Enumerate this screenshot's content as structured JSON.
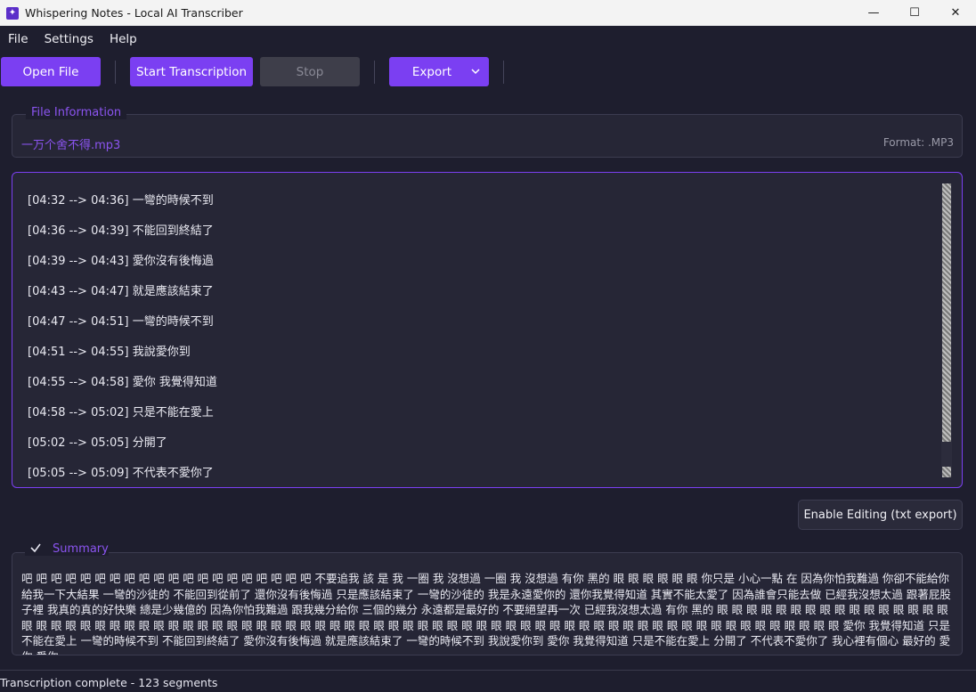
{
  "window": {
    "title": "Whispering Notes - Local AI Transcriber",
    "minimize_glyph": "—",
    "maximize_glyph": "☐",
    "close_glyph": "✕"
  },
  "menu": [
    "File",
    "Settings",
    "Help"
  ],
  "toolbar": {
    "open_file": "Open File",
    "start": "Start Transcription",
    "stop": "Stop",
    "export": "Export"
  },
  "file_info": {
    "group_title": "File Information",
    "file_name": "一万个舍不得.mp3",
    "format": "Format: .MP3"
  },
  "transcript": [
    "[04:32 --> 04:36] 一彎的時候不到",
    "[04:36 --> 04:39] 不能回到終結了",
    "[04:39 --> 04:43] 愛你沒有後悔過",
    "[04:43 --> 04:47] 就是應該結束了",
    "[04:47 --> 04:51] 一彎的時候不到",
    "[04:51 --> 04:55] 我說愛你到",
    "[04:55 --> 04:58] 愛你 我覺得知道",
    "[04:58 --> 05:02] 只是不能在愛上",
    "[05:02 --> 05:05] 分開了",
    "[05:05 --> 05:09] 不代表不愛你了"
  ],
  "edit_button": "Enable Editing (txt export)",
  "summary": {
    "label": "Summary",
    "checked": true,
    "text": "吧 吧 吧 吧 吧 吧 吧 吧 吧 吧 吧 吧 吧 吧 吧 吧 吧 吧 吧 吧 不要追我 該 是 我 一圈 我 沒想過 一圈 我 沒想過 有你 黑的 眼 眼 眼 眼 眼 眼 你只是 小心一點 在 因為你怕我難過 你卻不能給你 給我一下大結果 一彎的沙徒的 不能回到從前了 還你沒有後悔過 只是應該結束了 一彎的沙徒的 我是永遠愛你的 還你我覺得知道 其實不能太愛了 因為誰會只能去做 已經我沒想太過 跟著屁股子裡 我真的真的好快樂 總是少幾億的 因為你怕我難過 跟我幾分給你 三個的幾分 永遠都是最好的 不要絕望再一次 已經我沒想太過 有你 黑的 眼 眼 眼 眼 眼 眼 眼 眼 眼 眼 眼 眼 眼 眼 眼 眼 眼 眼 眼 眼 眼 眼 眼 眼 眼 眼 眼 眼 眼 眼 眼 眼 眼 眼 眼 眼 眼 眼 眼 眼 眼 眼 眼 眼 眼 眼 眼 眼 眼 眼 眼 眼 眼 眼 眼 眼 眼 眼 眼 眼 眼 眼 眼 眼 眼 眼 眼 眼 眼 眼 眼 眼 愛你 我覺得知道 只是不能在愛上 一彎的時候不到 不能回到終結了 愛你沒有後悔過 就是應該結束了 一彎的時候不到 我說愛你到 愛你 我覺得知道 只是不能在愛上 分開了 不代表不愛你了 我心裡有個心 最好的 愛你 愛你"
  },
  "status": "Transcription complete - 123 segments",
  "colors": {
    "accent": "#7b3ff2",
    "background": "#1e1e2e",
    "panel": "#262636"
  }
}
